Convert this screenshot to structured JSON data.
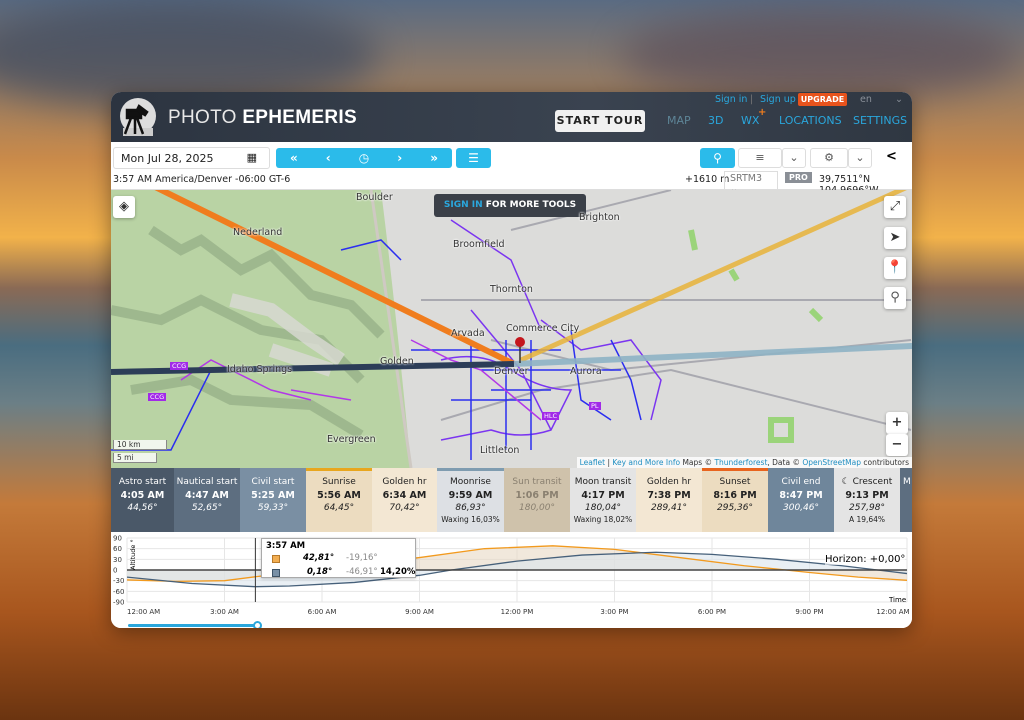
{
  "header": {
    "brand_light": "PHOTO",
    "brand_bold": "EPHEMERIS",
    "start_tour": "START TOUR",
    "nav": [
      "MAP",
      "3D",
      "WX",
      "LOCATIONS",
      "SETTINGS"
    ],
    "wx_badge": "+",
    "sign_in": "Sign in",
    "separator": "|",
    "sign_up": "Sign up",
    "upgrade": "UPGRADE",
    "language": "en"
  },
  "toolbar": {
    "date": "Mon Jul 28, 2025",
    "time_zone": "3:57 AM America/Denver -06:00 GT-6",
    "elevation": "+1610 m",
    "elevation_source": "SRTM3",
    "pro": "PRO",
    "coordinates": "39,7511°N 104,9696°W"
  },
  "map": {
    "sign_in_tools_a": "SIGN IN",
    "sign_in_tools_b": " FOR MORE TOOLS",
    "labels": [
      "Boulder",
      "Nederland",
      "Broomfield",
      "Brighton",
      "Thornton",
      "Arvada",
      "Commerce City",
      "Golden",
      "Idaho Springs",
      "Denver",
      "Aurora",
      "Evergreen",
      "Littleton",
      "CCG",
      "CCG",
      "HLC",
      "PL"
    ],
    "scale_km": "10 km",
    "scale_mi": "5 mi",
    "attribution": {
      "leaflet": "Leaflet",
      "sep": " | ",
      "key": "Key and More Info",
      "maps": " Maps © ",
      "thunderforest": "Thunderforest",
      "data": ", Data © ",
      "osm": "OpenStreetMap",
      "contrib": " contributors"
    },
    "zoom_in": "+",
    "zoom_out": "−"
  },
  "events": [
    {
      "label": "Astro start",
      "time": "4:05 AM",
      "angle": "44,56°",
      "bg": "#4a5868",
      "fg": "#fff"
    },
    {
      "label": "Nautical start",
      "time": "4:47 AM",
      "angle": "52,65°",
      "bg": "#5d6e80",
      "fg": "#fff"
    },
    {
      "label": "Civil start",
      "time": "5:25 AM",
      "angle": "59,33°",
      "bg": "#7a8fa3",
      "fg": "#fff"
    },
    {
      "label": "Sunrise",
      "time": "5:56 AM",
      "angle": "64,45°",
      "bg": "#ecdcc0",
      "fg": "#222",
      "bar": "#e8a61e"
    },
    {
      "label": "Golden hr",
      "time": "6:34 AM",
      "angle": "70,42°",
      "bg": "#f3e7d3",
      "fg": "#222"
    },
    {
      "label": "Moonrise",
      "time": "9:59 AM",
      "angle": "86,93°",
      "extra": "Waxing 16,03%",
      "bg": "#dde0e4",
      "fg": "#222",
      "bar": "#7f9cb0"
    },
    {
      "label": "Sun transit",
      "time": "1:06 PM",
      "angle": "180,00°",
      "bg": "#cfc2ab",
      "fg": "#8a8070"
    },
    {
      "label": "Moon transit",
      "time": "4:17 PM",
      "angle": "180,04°",
      "extra": "Waxing 18,02%",
      "bg": "#e4e4e4",
      "fg": "#222"
    },
    {
      "label": "Golden hr",
      "time": "7:38 PM",
      "angle": "289,41°",
      "bg": "#f3e7d3",
      "fg": "#222"
    },
    {
      "label": "Sunset",
      "time": "8:16 PM",
      "angle": "295,36°",
      "bg": "#ecdcc0",
      "fg": "#222",
      "bar": "#e8641e"
    },
    {
      "label": "Civil end",
      "time": "8:47 PM",
      "angle": "300,46°",
      "bg": "#6f869b",
      "fg": "#fff"
    },
    {
      "label": "☾ Crescent",
      "time": "9:13 PM",
      "angle": "257,98°",
      "extra": "A 19,64%",
      "bg": "#e4e4e4",
      "fg": "#222"
    },
    {
      "label": "M",
      "time": "",
      "angle": "",
      "bg": "#5d6e80",
      "fg": "#fff"
    }
  ],
  "tooltip": {
    "time": "3:57 AM",
    "sun_alt": "42,81°",
    "sun_el": "-19,16°",
    "moon_alt": "0,18°",
    "moon_el": "-46,91°",
    "moon_illum": "14,20%"
  },
  "chart_data": {
    "type": "line",
    "ylabel": "Altitude °",
    "xlabel": "Time",
    "horizon_label": "Horizon: +0,00°",
    "yticks": [
      "90",
      "60",
      "30",
      "0",
      "-30",
      "-60",
      "-90"
    ],
    "ylim": [
      -90,
      90
    ],
    "xticks": [
      "12:00 AM",
      "3:00 AM",
      "6:00 AM",
      "9:00 AM",
      "12:00 PM",
      "3:00 PM",
      "6:00 PM",
      "9:00 PM",
      "12:00 AM"
    ],
    "xlim": [
      0,
      24
    ],
    "cursor_hour": 3.95,
    "series": [
      {
        "name": "Sun",
        "color": "#f29a1e",
        "x": [
          0,
          1.5,
          3,
          3.95,
          5,
          5.93,
          7,
          9,
          11,
          13.1,
          15,
          17,
          19,
          20.27,
          21,
          22.5,
          24
        ],
        "y": [
          -28,
          -32,
          -30,
          -19,
          -8,
          0,
          12,
          35,
          60,
          68,
          58,
          35,
          12,
          0,
          -7,
          -20,
          -29
        ]
      },
      {
        "name": "Moon",
        "color": "#46607a",
        "x": [
          0,
          2,
          3.95,
          5,
          7,
          9,
          9.98,
          12,
          14,
          16.28,
          18,
          20,
          22,
          24
        ],
        "y": [
          -20,
          -38,
          -47,
          -45,
          -35,
          -15,
          0,
          25,
          42,
          50,
          44,
          30,
          12,
          -10
        ]
      }
    ]
  }
}
